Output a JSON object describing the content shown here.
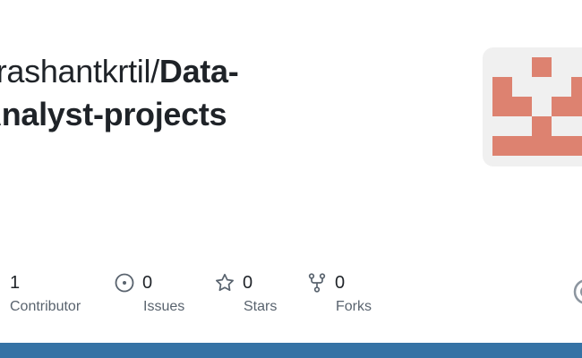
{
  "repo": {
    "owner": "prashantkrtil/",
    "name_line1": "Data-",
    "name_line2": "Analyst-projects"
  },
  "avatar": {
    "icon": "identicon",
    "color": "#dd8270",
    "background": "#f0f0f0"
  },
  "stats": [
    {
      "icon": "people-icon",
      "count": "1",
      "label": "Contributor"
    },
    {
      "icon": "issue-opened-icon",
      "count": "0",
      "label": "Issues"
    },
    {
      "icon": "star-icon",
      "count": "0",
      "label": "Stars"
    },
    {
      "icon": "repo-forked-icon",
      "count": "0",
      "label": "Forks"
    }
  ],
  "footer": {
    "language_color": "#3572a5"
  },
  "colors": {
    "text": "#1f2328",
    "muted": "#59636e"
  }
}
